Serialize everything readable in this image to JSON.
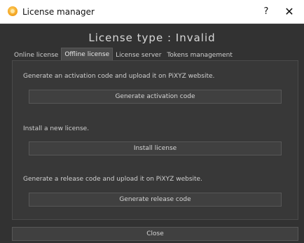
{
  "window": {
    "title": "License manager",
    "help_label": "?",
    "close_label": "✕",
    "icon": "pixyz-logo-icon"
  },
  "header": {
    "license_type": "License type : Invalid"
  },
  "tabs": [
    {
      "label": "Online license",
      "active": false
    },
    {
      "label": "Offline license",
      "active": true
    },
    {
      "label": "License server",
      "active": false
    },
    {
      "label": "Tokens management",
      "active": false
    }
  ],
  "offline": {
    "activation_desc": "Generate an activation code and upload it on PiXYZ website.",
    "activation_button": "Generate activation code",
    "install_desc": "Install a new license.",
    "install_button": "Install license",
    "release_desc": "Generate a release code and upload it on PiXYZ website.",
    "release_button": "Generate release code"
  },
  "footer": {
    "close_button": "Close"
  },
  "colors": {
    "background": "#323232",
    "panel": "#383838",
    "button": "#404040",
    "titlebar": "#ffffff",
    "icon_accent": "#f4a623"
  }
}
